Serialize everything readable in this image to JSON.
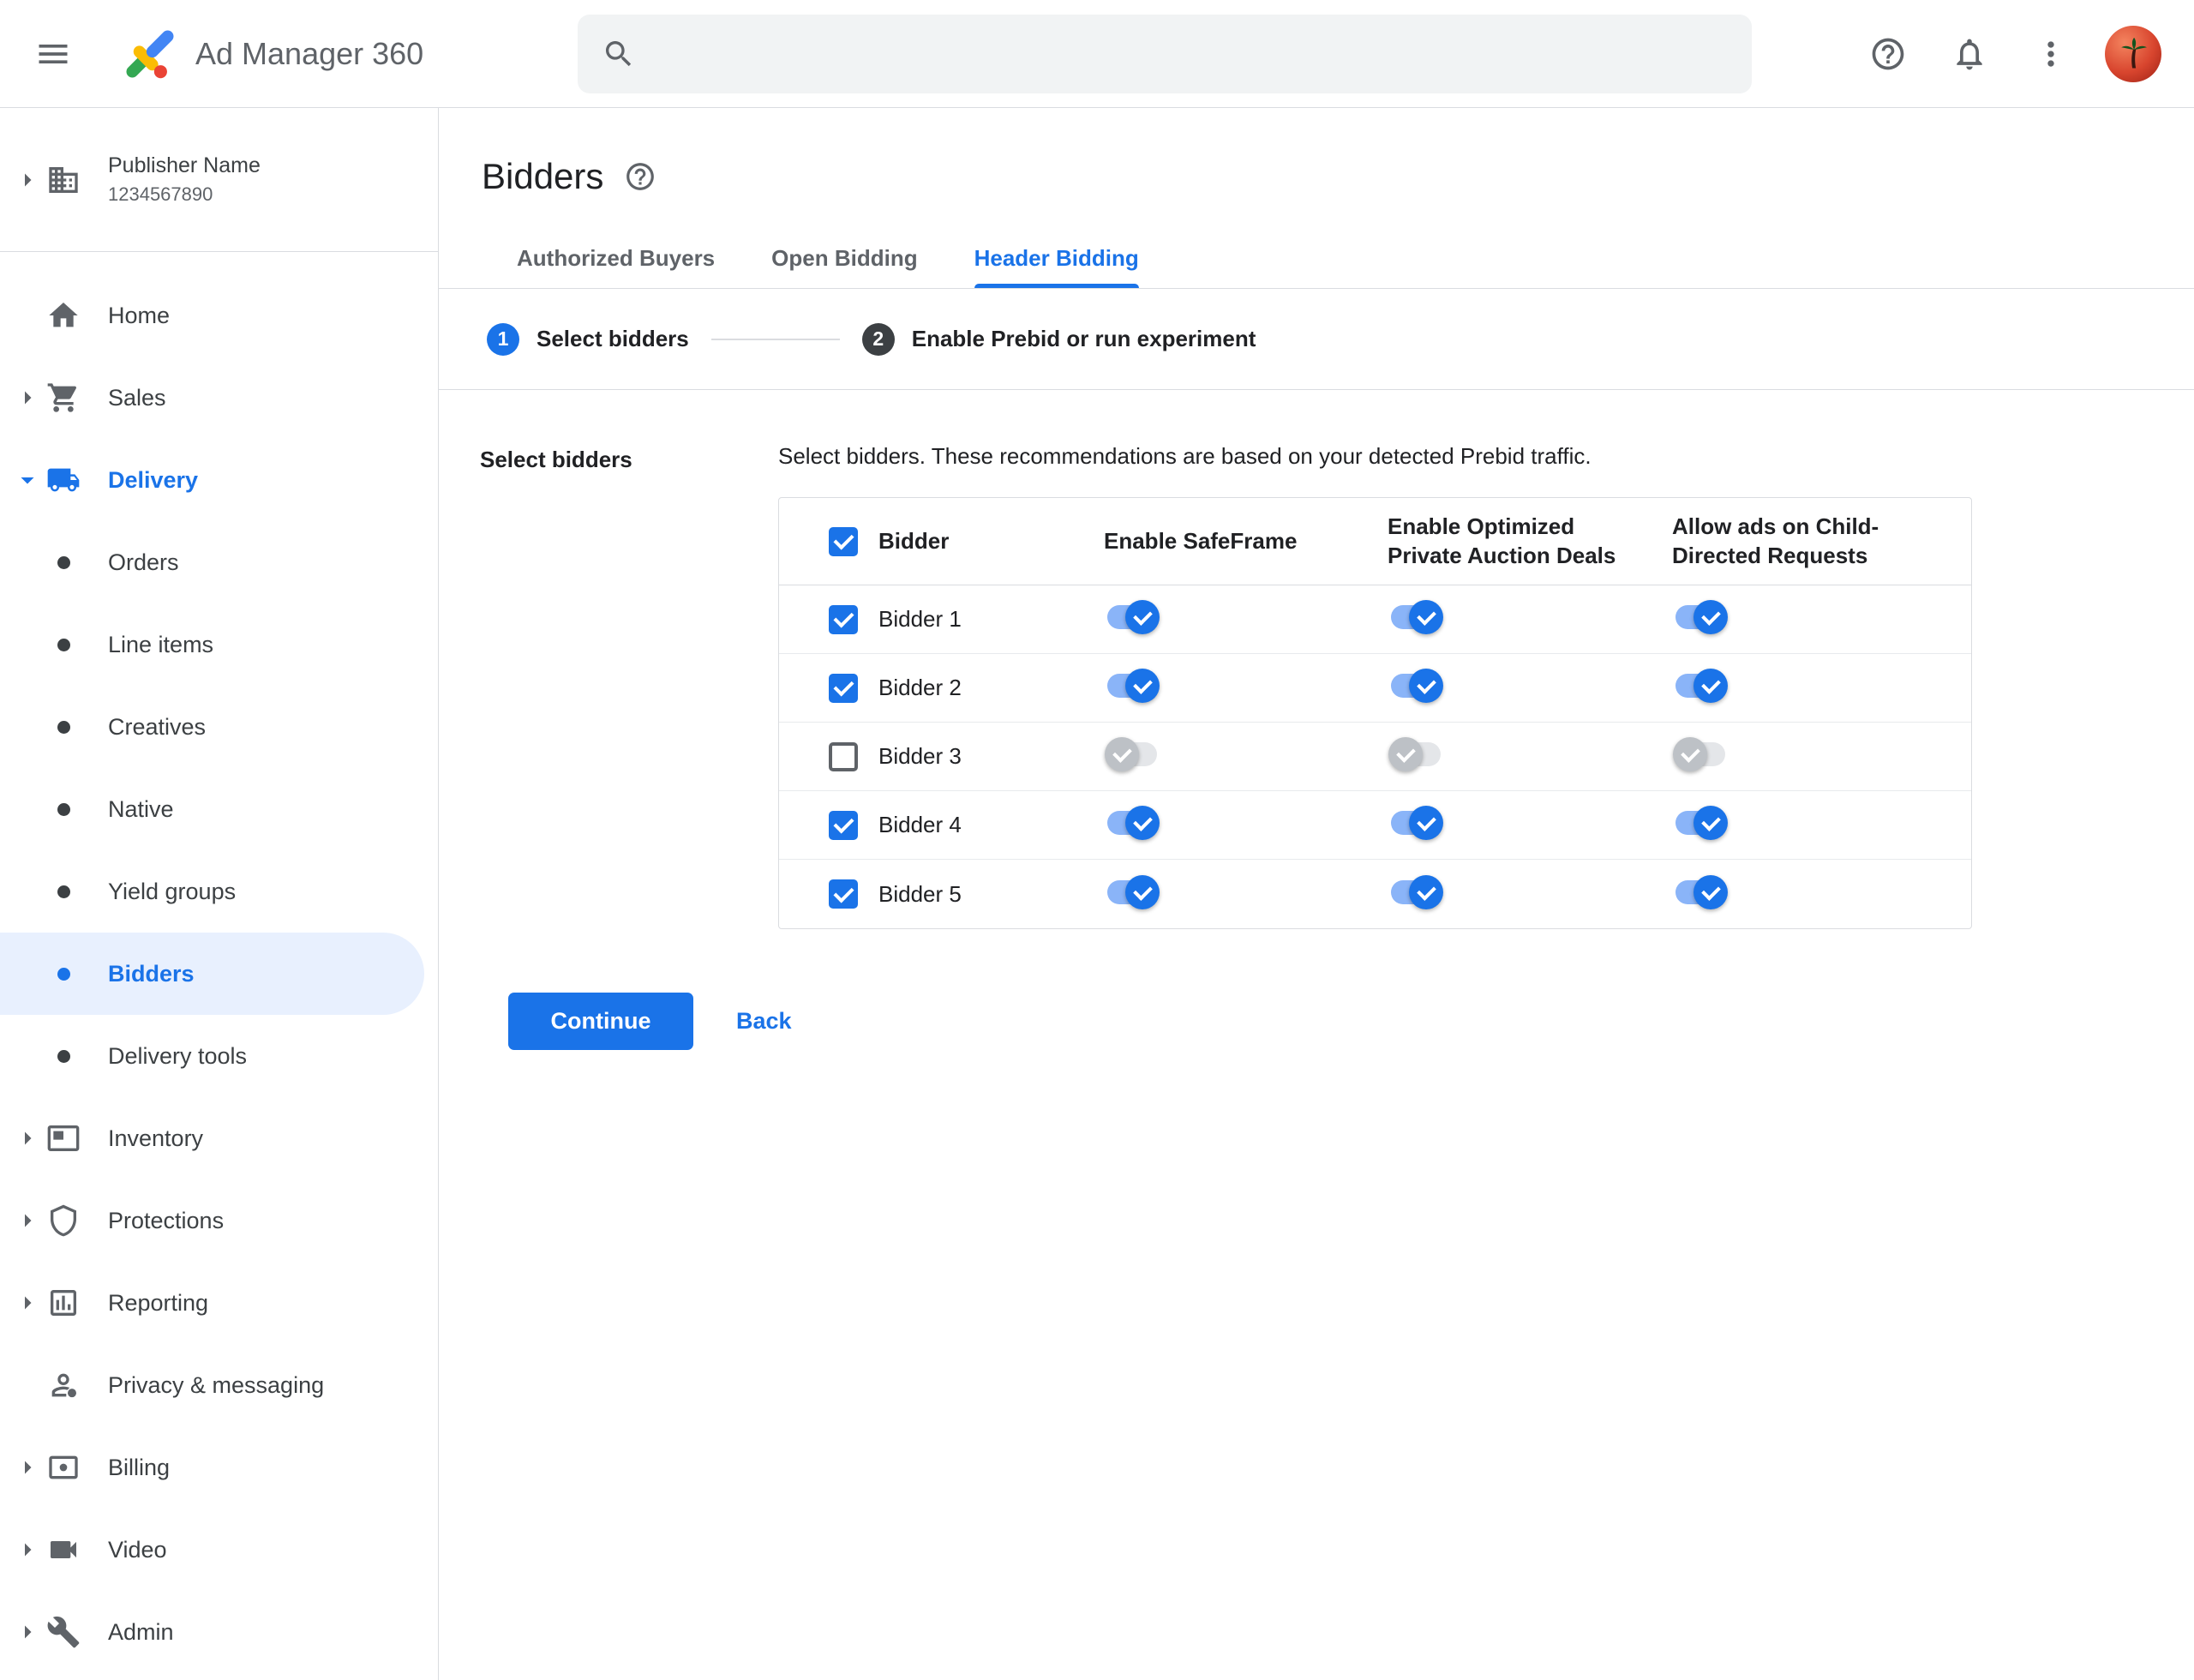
{
  "topbar": {
    "app_title": "Ad Manager 360",
    "search_placeholder": "",
    "search_value": ""
  },
  "sidebar": {
    "publisher": {
      "name": "Publisher Name",
      "id": "1234567890",
      "icon": "building-icon"
    },
    "items": [
      {
        "label": "Home",
        "icon": "home-icon",
        "chevron": false
      },
      {
        "label": "Sales",
        "icon": "cart-icon",
        "chevron": true
      },
      {
        "label": "Delivery",
        "icon": "truck-icon",
        "chevron": true,
        "expanded": true,
        "active": true
      },
      {
        "label": "Inventory",
        "icon": "inventory-icon",
        "chevron": true
      },
      {
        "label": "Protections",
        "icon": "shield-icon",
        "chevron": true
      },
      {
        "label": "Reporting",
        "icon": "report-icon",
        "chevron": true
      },
      {
        "label": "Privacy & messaging",
        "icon": "privacy-icon",
        "chevron": false
      },
      {
        "label": "Billing",
        "icon": "billing-icon",
        "chevron": true
      },
      {
        "label": "Video",
        "icon": "video-icon",
        "chevron": true
      },
      {
        "label": "Admin",
        "icon": "admin-icon",
        "chevron": true
      }
    ],
    "delivery_subitems": [
      {
        "label": "Orders",
        "selected": false
      },
      {
        "label": "Line items",
        "selected": false
      },
      {
        "label": "Creatives",
        "selected": false
      },
      {
        "label": "Native",
        "selected": false
      },
      {
        "label": "Yield groups",
        "selected": false
      },
      {
        "label": "Bidders",
        "selected": true
      },
      {
        "label": "Delivery tools",
        "selected": false
      }
    ]
  },
  "page": {
    "title": "Bidders",
    "tabs": [
      {
        "label": "Authorized Buyers",
        "active": false
      },
      {
        "label": "Open Bidding",
        "active": false
      },
      {
        "label": "Header Bidding",
        "active": true
      }
    ],
    "stepper": [
      {
        "number": "1",
        "label": "Select bidders",
        "active": true
      },
      {
        "number": "2",
        "label": "Enable Prebid or run experiment",
        "active": false
      }
    ],
    "section_label": "Select bidders",
    "description": "Select bidders. These recommendations are based on your detected Prebid traffic.",
    "table": {
      "header_checked": true,
      "headers": [
        "Bidder",
        "Enable SafeFrame",
        "Enable Optimized Private Auction Deals",
        "Allow ads on Child-Directed Requests"
      ],
      "rows": [
        {
          "name": "Bidder 1",
          "checked": true,
          "toggles": [
            true,
            true,
            true
          ]
        },
        {
          "name": "Bidder 2",
          "checked": true,
          "toggles": [
            true,
            true,
            true
          ]
        },
        {
          "name": "Bidder 3",
          "checked": false,
          "toggles": [
            false,
            false,
            false
          ]
        },
        {
          "name": "Bidder 4",
          "checked": true,
          "toggles": [
            true,
            true,
            true
          ]
        },
        {
          "name": "Bidder 5",
          "checked": true,
          "toggles": [
            true,
            true,
            true
          ]
        }
      ]
    },
    "continue_label": "Continue",
    "back_label": "Back"
  },
  "colors": {
    "accent": "#1a73e8",
    "selected_nav_bg": "#e8f0fe",
    "toggle_on_track": "#8ab4f8",
    "toggle_on_thumb": "#1a73e8",
    "toggle_off_track": "#e4e6e9",
    "toggle_off_thumb": "#bdc1c6",
    "step_inactive_circle": "#3c4043",
    "logo_blue": "#4285f4",
    "logo_green": "#34a853",
    "logo_yellow": "#fbbc04",
    "logo_red": "#ea4335"
  }
}
